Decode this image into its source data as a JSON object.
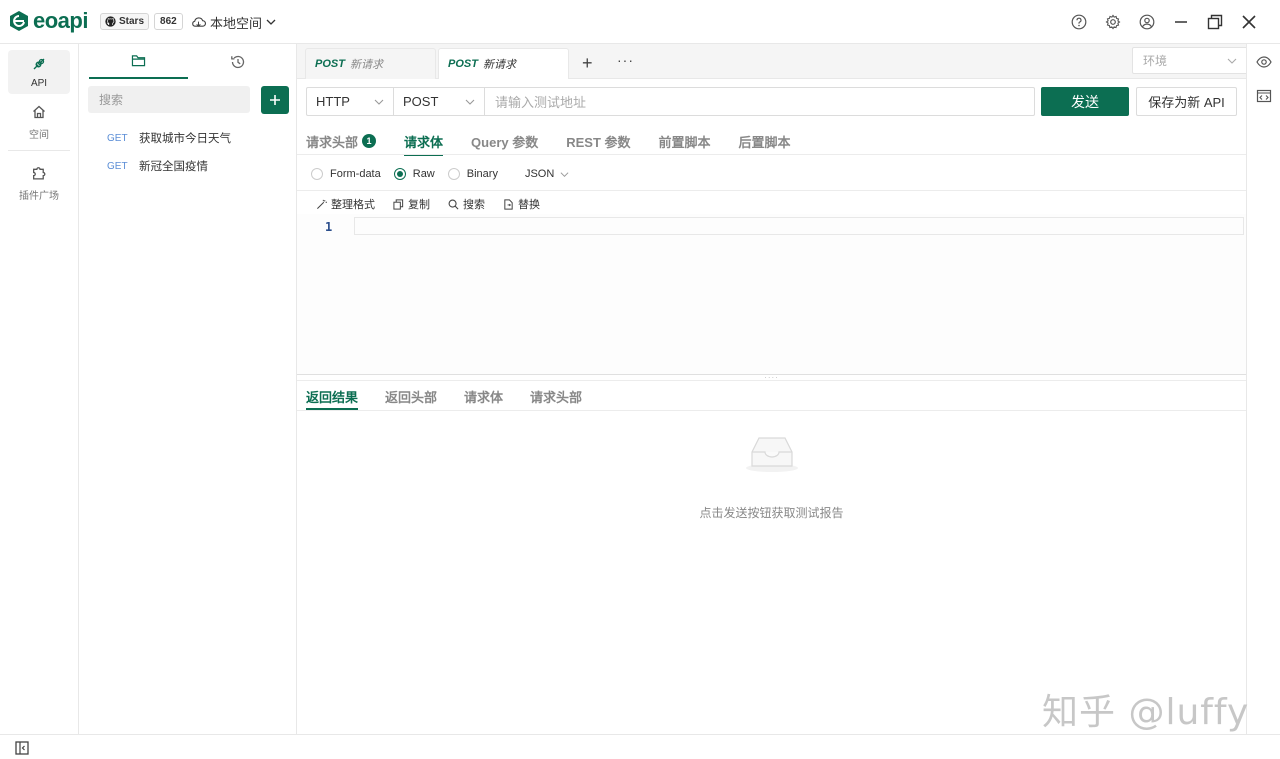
{
  "app": {
    "logo_text": "eoapi",
    "brand_color": "#0c6e52"
  },
  "github": {
    "stars_label": "Stars",
    "stars_count": "862"
  },
  "workspace": {
    "label": "本地空间"
  },
  "leftnav": {
    "items": [
      {
        "label": "API",
        "icon": "api-icon",
        "active": true
      },
      {
        "label": "空间",
        "icon": "home-icon"
      },
      {
        "label": "插件广场",
        "icon": "puzzle-icon"
      }
    ]
  },
  "sidebar": {
    "search_placeholder": "搜索",
    "apis": [
      {
        "method": "GET",
        "name": "获取城市今日天气"
      },
      {
        "method": "GET",
        "name": "新冠全国疫情"
      }
    ]
  },
  "tabs": [
    {
      "method": "POST",
      "name": "新请求",
      "active": false
    },
    {
      "method": "POST",
      "name": "新请求",
      "active": true
    }
  ],
  "env": {
    "placeholder": "环境"
  },
  "request": {
    "protocol": "HTTP",
    "method": "POST",
    "url_placeholder": "请输入测试地址",
    "send_label": "发送",
    "save_label": "保存为新 API"
  },
  "req_tabs": [
    {
      "label": "请求头部",
      "badge": "1"
    },
    {
      "label": "请求体",
      "active": true
    },
    {
      "label": "Query 参数"
    },
    {
      "label": "REST 参数"
    },
    {
      "label": "前置脚本"
    },
    {
      "label": "后置脚本"
    }
  ],
  "body_types": [
    {
      "label": "Form-data"
    },
    {
      "label": "Raw",
      "checked": true
    },
    {
      "label": "Binary"
    }
  ],
  "body_format": "JSON",
  "editor_toolbar": {
    "format": "整理格式",
    "copy": "复制",
    "search": "搜索",
    "replace": "替换"
  },
  "editor": {
    "line_number": "1"
  },
  "res_tabs": [
    {
      "label": "返回结果",
      "active": true
    },
    {
      "label": "返回头部"
    },
    {
      "label": "请求体"
    },
    {
      "label": "请求头部"
    }
  ],
  "empty_text": "点击发送按钮获取测试报告",
  "watermark": "知乎 @luffy"
}
